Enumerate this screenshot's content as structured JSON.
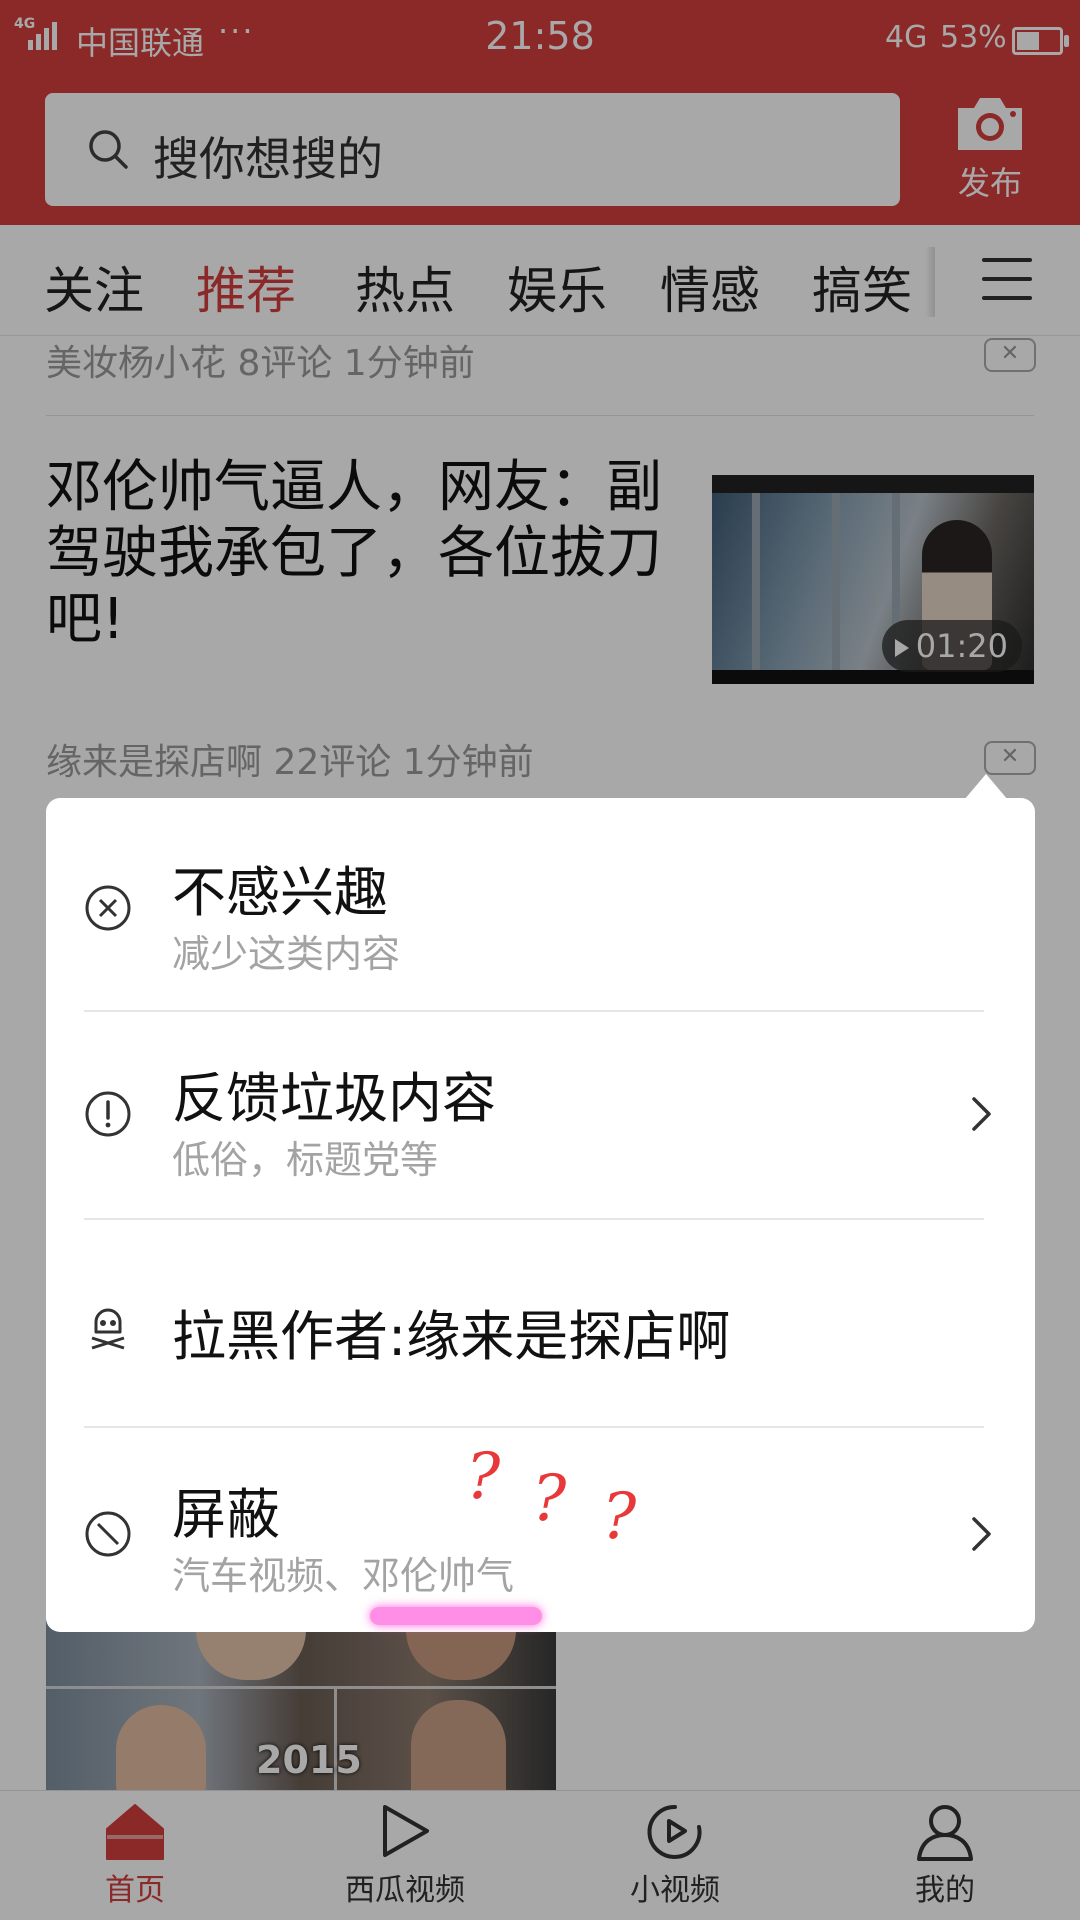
{
  "status_bar": {
    "network_type": "4G",
    "carrier": "中国联通",
    "more": "···",
    "time": "21:58",
    "net": "4G",
    "battery": "53%",
    "battery_level": 0.53
  },
  "header": {
    "search_placeholder": "搜你想搜的",
    "publish_label": "发布"
  },
  "tabs": [
    "关注",
    "推荐",
    "热点",
    "娱乐",
    "情感",
    "搞笑"
  ],
  "active_tab": "推荐",
  "feed": {
    "prev_meta": "美妆杨小花  8评论  1分钟前",
    "article_title": "邓伦帅气逼人，网友：副驾驶我承包了，各位拔刀吧!",
    "video_duration": "01:20",
    "article_meta": "缘来是探店啊  22评论  1分钟前",
    "bottom_thumb_text": "2015"
  },
  "popup": {
    "options": [
      {
        "title": "不感兴趣",
        "subtitle": "减少这类内容",
        "icon": "close-circle-icon",
        "has_arrow": false
      },
      {
        "title": "反馈垃圾内容",
        "subtitle": "低俗，标题党等",
        "icon": "exclamation-circle-icon",
        "has_arrow": true
      },
      {
        "title": "拉黑作者:缘来是探店啊",
        "subtitle": "",
        "icon": "skull-icon",
        "has_arrow": false
      },
      {
        "title": "屏蔽",
        "subtitle": "汽车视频、邓伦帅气",
        "icon": "block-icon",
        "has_arrow": true
      }
    ],
    "annotation_marks": [
      "?",
      "?",
      "?"
    ]
  },
  "bottom_nav": [
    {
      "label": "首页",
      "icon": "home-icon",
      "active": true
    },
    {
      "label": "西瓜视频",
      "icon": "play-icon",
      "active": false
    },
    {
      "label": "小视频",
      "icon": "short-video-icon",
      "active": false
    },
    {
      "label": "我的",
      "icon": "profile-icon",
      "active": false
    }
  ],
  "colors": {
    "brand_red": "#d43d3d",
    "annotation_red": "#e8393a",
    "highlight_pink": "#ff8fe6"
  }
}
